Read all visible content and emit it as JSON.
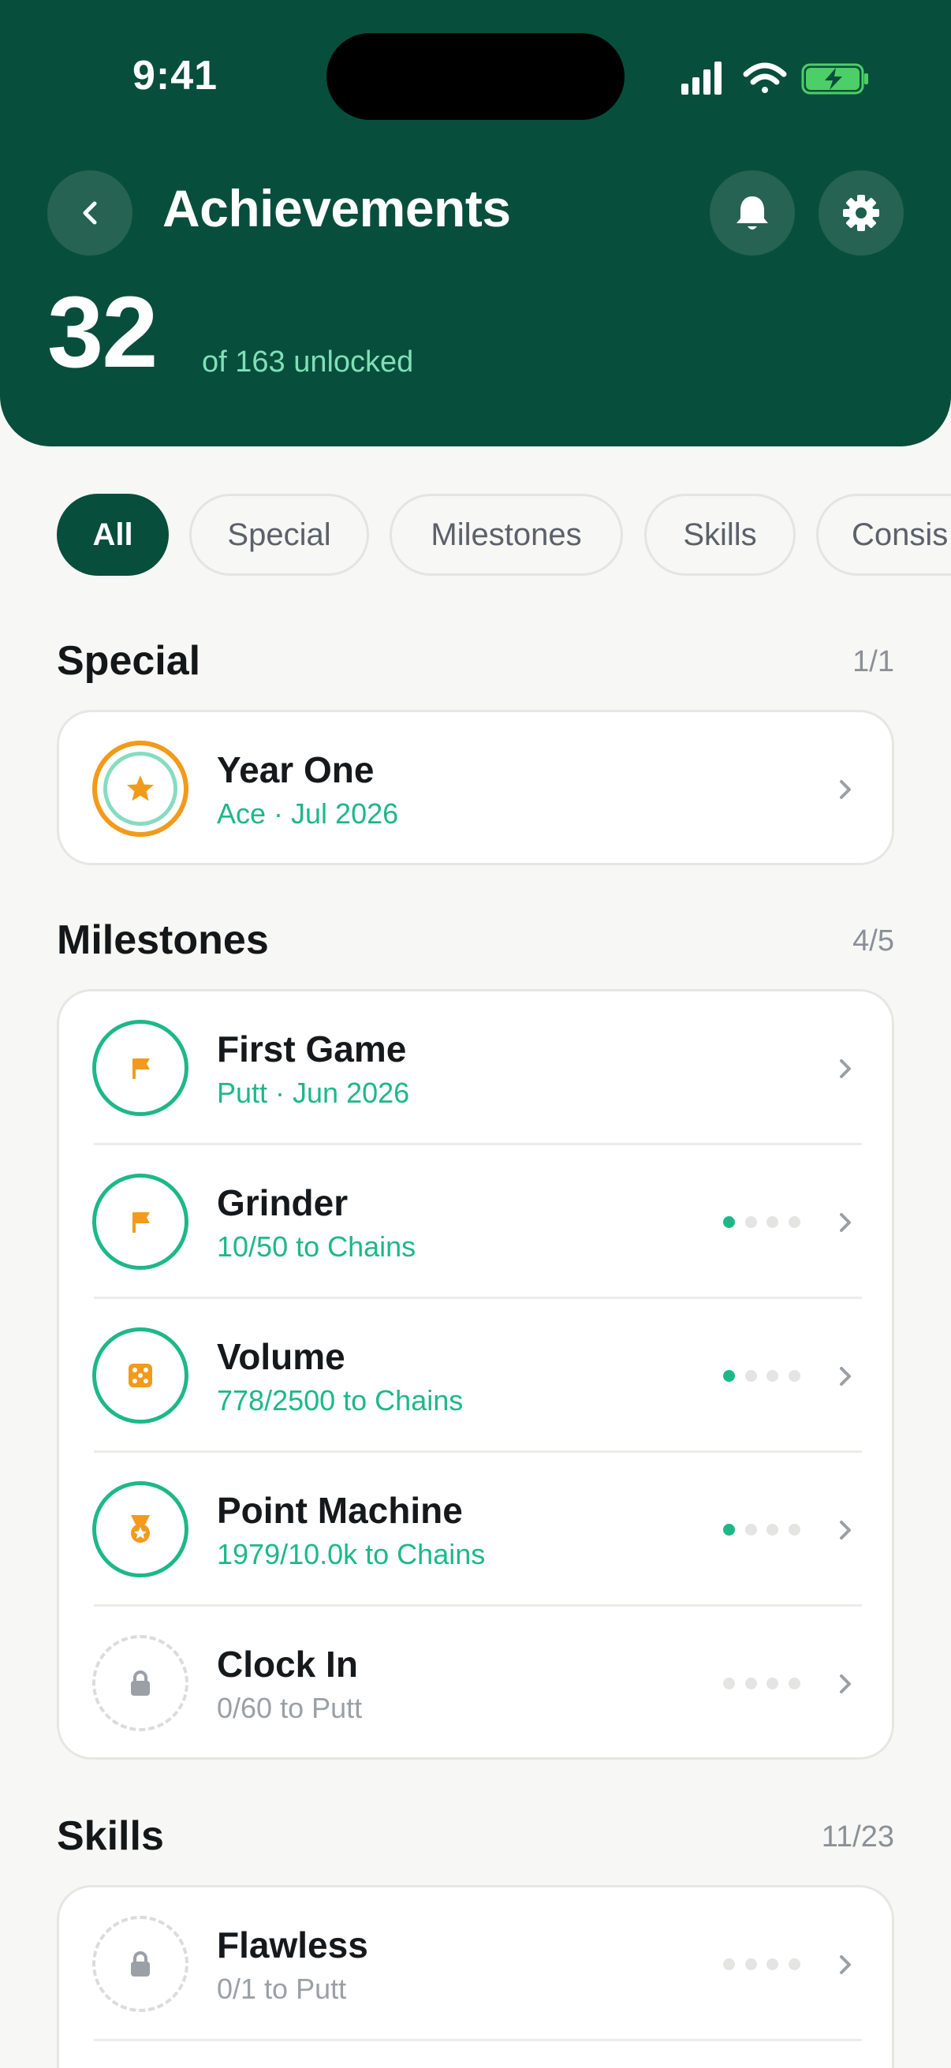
{
  "status": {
    "time": "9:41"
  },
  "header": {
    "title": "Achievements",
    "unlocked_count": "32",
    "unlocked_sub": "of 163 unlocked"
  },
  "filters": [
    "All",
    "Special",
    "Milestones",
    "Skills",
    "Consis"
  ],
  "colors": {
    "brand": "#084e3c",
    "accent": "#1db887",
    "gold": "#f29a1b",
    "muted": "#9aa0a6"
  },
  "sections": {
    "special": {
      "title": "Special",
      "count": "1/1",
      "items": [
        {
          "title": "Year One",
          "subtitle": "Ace · Jul 2026",
          "icon": "star-icon",
          "state": "ace"
        }
      ]
    },
    "milestones": {
      "title": "Milestones",
      "count": "4/5",
      "items": [
        {
          "title": "First Game",
          "subtitle": "Putt · Jun 2026",
          "icon": "flag-icon",
          "state": "unlocked"
        },
        {
          "title": "Grinder",
          "subtitle": "10/50 to Chains",
          "icon": "flag-icon",
          "state": "unlocked",
          "tier_progress": 1
        },
        {
          "title": "Volume",
          "subtitle": "778/2500 to Chains",
          "icon": "dice-icon",
          "state": "unlocked",
          "tier_progress": 1
        },
        {
          "title": "Point Machine",
          "subtitle": "1979/10.0k to Chains",
          "icon": "medal-icon",
          "state": "unlocked",
          "tier_progress": 1
        },
        {
          "title": "Clock In",
          "subtitle": "0/60 to Putt",
          "icon": "lock-icon",
          "state": "locked",
          "tier_progress": 0
        }
      ]
    },
    "skills": {
      "title": "Skills",
      "count": "11/23",
      "items": [
        {
          "title": "Flawless",
          "subtitle": "0/1 to Putt",
          "icon": "lock-icon",
          "state": "locked",
          "tier_progress": 0
        }
      ]
    }
  }
}
